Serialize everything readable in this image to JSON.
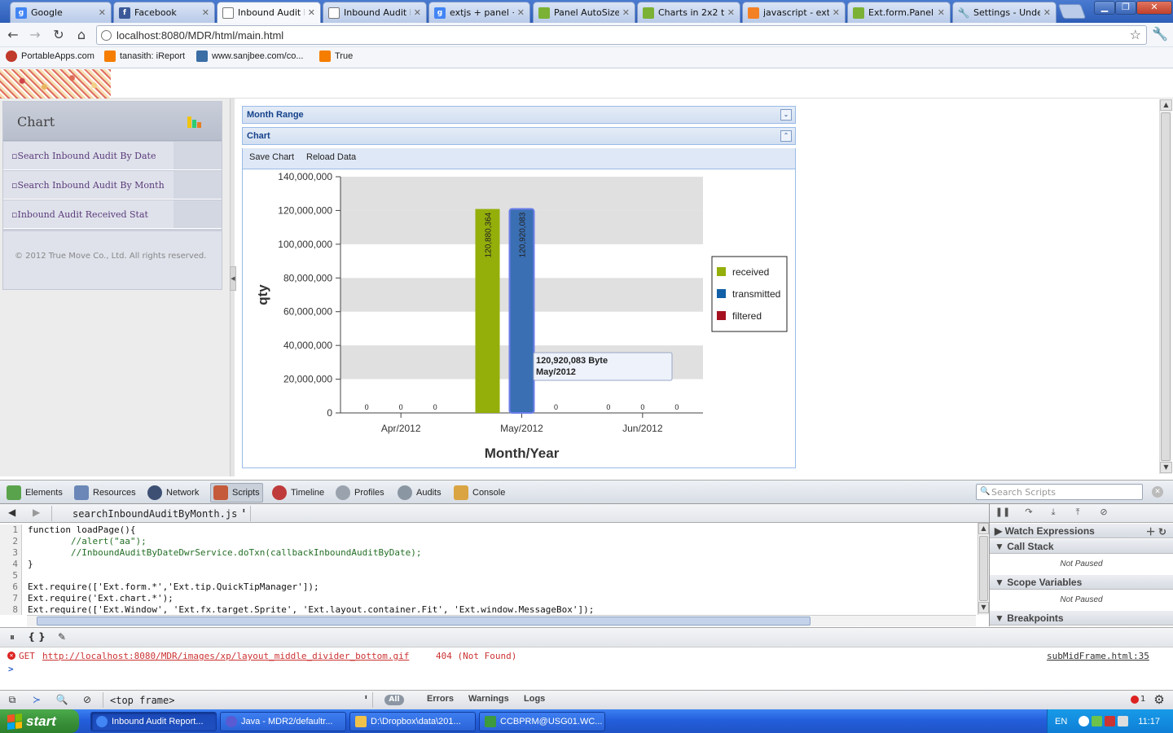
{
  "browser": {
    "tabs": [
      {
        "label": "Google",
        "icon": "google-icon",
        "color": "#4285f4"
      },
      {
        "label": "Facebook",
        "icon": "facebook-icon",
        "color": "#3b5998"
      },
      {
        "label": "Inbound Audit R",
        "icon": "page-icon",
        "color": "#7a7a7a",
        "active": true
      },
      {
        "label": "Inbound Audit B",
        "icon": "page-icon",
        "color": "#7a7a7a"
      },
      {
        "label": "extjs + panel +a",
        "icon": "google-icon",
        "color": "#4285f4"
      },
      {
        "label": "Panel AutoSize I",
        "icon": "sencha-icon",
        "color": "#7bb135"
      },
      {
        "label": "Charts in 2x2 tal",
        "icon": "sencha-icon",
        "color": "#7bb135"
      },
      {
        "label": "javascript - extJ",
        "icon": "stackoverflow-icon",
        "color": "#f48024"
      },
      {
        "label": "Ext.form.Panel -",
        "icon": "sencha-icon",
        "color": "#7bb135"
      },
      {
        "label": "Settings - Under",
        "icon": "wrench-icon",
        "color": "#777777"
      }
    ],
    "url": "localhost:8080/MDR/html/main.html",
    "bookmarks": [
      {
        "label": "PortableApps.com",
        "color": "#c0392b"
      },
      {
        "label": "tanasith: iReport",
        "color": "#f57d00"
      },
      {
        "label": "www.sanjbee.com/co...",
        "color": "#3a6ea5"
      },
      {
        "label": "True",
        "color": "#f57d00"
      }
    ]
  },
  "sidebar": {
    "title": "Chart",
    "items": [
      {
        "label": "Search Inbound Audit By Date"
      },
      {
        "label": "Search Inbound Audit By Month"
      },
      {
        "label": "Inbound Audit Received Stat"
      }
    ],
    "footer": "© 2012 True Move Co., Ltd. All rights reserved."
  },
  "panels": {
    "month_range_title": "Month Range",
    "chart_title": "Chart",
    "save_chart": "Save Chart",
    "reload_data": "Reload Data"
  },
  "chart_data": {
    "type": "bar",
    "categories": [
      "Apr/2012",
      "May/2012",
      "Jun/2012"
    ],
    "series": [
      {
        "name": "received",
        "color": "#94ae0a",
        "values": [
          0,
          120880364,
          0
        ]
      },
      {
        "name": "transmitted",
        "color": "#115fa6",
        "values": [
          0,
          120920083,
          0
        ]
      },
      {
        "name": "filtered",
        "color": "#a61120",
        "values": [
          0,
          0,
          0
        ]
      }
    ],
    "value_labels": [
      [
        "0",
        "120,880,364",
        "0"
      ],
      [
        "0",
        "120,920,083",
        "0"
      ],
      [
        "0",
        "0",
        "0"
      ]
    ],
    "xlabel": "Month/Year",
    "ylabel": "Qty",
    "ylim": [
      0,
      140000000
    ],
    "yticks": [
      "0",
      "20,000,000",
      "40,000,000",
      "60,000,000",
      "80,000,000",
      "100,000,000",
      "120,000,000",
      "140,000,000"
    ],
    "legend_position": "right",
    "grid": "alternating horizontal bands",
    "tooltip": {
      "line1": "120,920,083 Byte",
      "line2": "May/2012"
    }
  },
  "devtools": {
    "tabs": [
      "Elements",
      "Resources",
      "Network",
      "Scripts",
      "Timeline",
      "Profiles",
      "Audits",
      "Console"
    ],
    "active_tab": "Scripts",
    "search_placeholder": "Search Scripts",
    "file": "searchInboundAuditByMonth.js",
    "code_lines": [
      "function loadPage(){",
      "        //alert(\"aa\");",
      "        //InboundAuditByDateDwrService.doTxn(callbackInboundAuditByDate);",
      "}",
      "",
      "Ext.require(['Ext.form.*','Ext.tip.QuickTipManager']);",
      "Ext.require('Ext.chart.*');",
      "Ext.require(['Ext.Window', 'Ext.fx.target.Sprite', 'Ext.layout.container.Fit', 'Ext.window.MessageBox']);",
      ""
    ],
    "panes": {
      "watch": "Watch Expressions",
      "call_stack": "Call Stack",
      "not_paused": "Not Paused",
      "scope": "Scope Variables",
      "breakpoints": "Breakpoints"
    },
    "console": {
      "error_text": "GET http://localhost:8080/MDR/images/xp/layout_middle_divider_bottom.gif 404 (Not Found)",
      "error_method": "GET",
      "error_url": "http://localhost:8080/MDR/images/xp/layout_middle_divider_bottom.gif",
      "error_status": "404 (Not Found)",
      "error_source": "subMidFrame.html:35",
      "prompt": ">"
    },
    "frame": "<top frame>",
    "filters": {
      "all": "All",
      "errors": "Errors",
      "warnings": "Warnings",
      "logs": "Logs"
    },
    "error_count": "1"
  },
  "taskbar": {
    "start": "start",
    "tasks": [
      {
        "label": "Inbound Audit Report...",
        "color": "#4285f4",
        "active": true
      },
      {
        "label": "Java - MDR2/defaultr...",
        "color": "#5a5ad2"
      },
      {
        "label": "D:\\Dropbox\\data\\201...",
        "color": "#f0c14b"
      },
      {
        "label": "CCBPRM@USG01.WC...",
        "color": "#3d9a3d"
      }
    ],
    "lang": "EN",
    "time": "11:17"
  }
}
